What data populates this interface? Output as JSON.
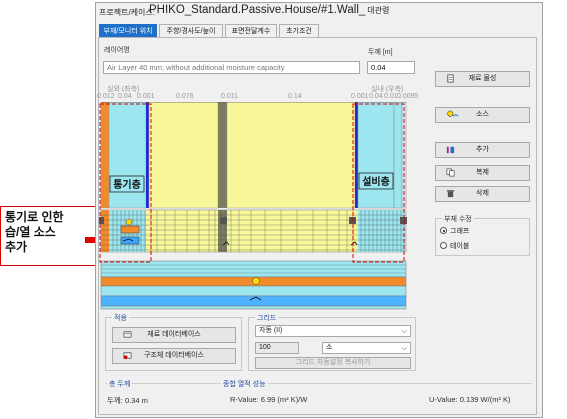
{
  "window": {
    "title_prefix": "프로젝트/케이스:",
    "title_name": "PHIKO_Standard.Passive.House/#1.Wall_",
    "title_suffix": "대관령"
  },
  "tabs": [
    {
      "label": "부재/모니터 위치",
      "active": true
    },
    {
      "label": "주향/경사도/높이",
      "active": false
    },
    {
      "label": "표면전달계수",
      "active": false
    },
    {
      "label": "초기조건",
      "active": false
    }
  ],
  "layer": {
    "name_label": "레이어명",
    "name_value": "Air Layer 40 mm; without additional moisture capacity",
    "thickness_label": "두께 [m]",
    "thickness_value": "0.04"
  },
  "diagram": {
    "exterior_label": "실외 (좌측)",
    "interior_label": "실내 (우측)",
    "thickness_labels": [
      "0.012",
      "0.04",
      "0.001",
      "0.076",
      "0.011",
      "0.14",
      "0.001",
      "0.04",
      "0.01",
      "0.0095"
    ],
    "left_zone_label": "통기층",
    "right_zone_label": "설비층"
  },
  "buttons": {
    "material_db": "재료 물성",
    "source": "소스",
    "add": "추가",
    "duplicate": "복제",
    "delete": "삭제"
  },
  "component_edit": {
    "title": "부재 수정",
    "options": [
      {
        "label": "그래프",
        "selected": true
      },
      {
        "label": "테이블",
        "selected": false
      }
    ]
  },
  "apply": {
    "title": "적용",
    "material_database": "재료 데이터베이스",
    "structure_database": "구조체 데이터베이스"
  },
  "grid": {
    "title": "그리드",
    "mode_value": "자동 (II)",
    "count_value": "100",
    "size_value": "소",
    "copy_button": "그리드 자동설정 복사하기"
  },
  "totals": {
    "total_thickness_title": "총 두께",
    "total_thickness": "두께: 0.34 m",
    "thermal_title": "종합 열적 성능",
    "r_value": "R-Value: 6.99 (m² K)/W",
    "u_value": "U-Value: 0.139 W/(m² K)"
  },
  "annotation": {
    "text_line1": "통기로 인한",
    "text_line2": "습/열 소스",
    "text_line3": "추가"
  },
  "colors": {
    "tab_active": "#1e6fc8",
    "layer_cyan": "#9be6ef",
    "layer_yellow": "#f8f89a",
    "layer_orange": "#f08a2a",
    "layer_darkgray": "#7b7d5e",
    "blue_line": "#1b2fd0",
    "annotation_red": "#d00000"
  }
}
